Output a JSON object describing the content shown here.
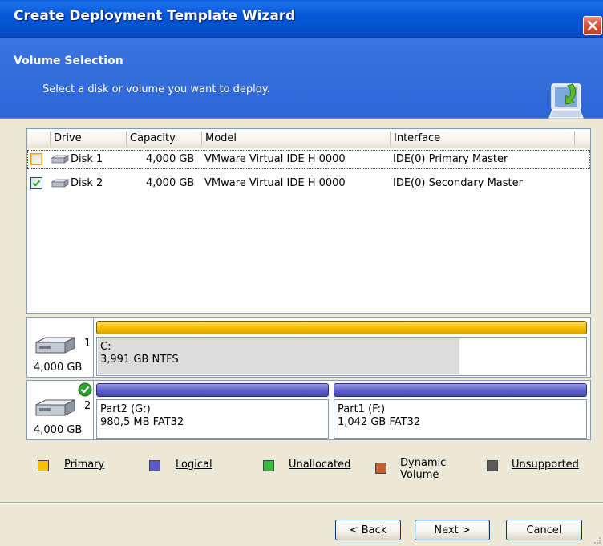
{
  "window": {
    "title": "Create Deployment Template Wizard"
  },
  "header": {
    "title": "Volume Selection",
    "subtitle": "Select a disk or volume you want to deploy."
  },
  "drive_list": {
    "columns": [
      "Drive",
      "Capacity",
      "Model",
      "Interface"
    ],
    "rows": [
      {
        "checked": false,
        "drive": "Disk 1",
        "capacity": "4,000 GB",
        "model": "VMware Virtual IDE H 0000",
        "interface": "IDE(0) Primary Master"
      },
      {
        "checked": true,
        "drive": "Disk 2",
        "capacity": "4,000 GB",
        "model": "VMware Virtual IDE H 0000",
        "interface": "IDE(0) Secondary Master"
      }
    ]
  },
  "disk_map": [
    {
      "number": "1",
      "size": "4,000 GB",
      "selected": false,
      "partitions": [
        {
          "type": "primary",
          "name": "C:",
          "info": "3,991 GB  NTFS",
          "used_fraction": 0.74
        }
      ]
    },
    {
      "number": "2",
      "size": "4,000 GB",
      "selected": true,
      "partitions": [
        {
          "type": "logical",
          "name": "Part2 (G:)",
          "info": "980,5 MB  FAT32"
        },
        {
          "type": "logical",
          "name": "Part1 (F:)",
          "info": "1,042 GB  FAT32"
        }
      ]
    }
  ],
  "legend": [
    {
      "label": "Primary",
      "color": "#F5C000"
    },
    {
      "label": "Logical",
      "color": "#5A5AD0"
    },
    {
      "label": "Unallocated",
      "color": "#3CB83C"
    },
    {
      "label": "Dynamic",
      "label2": "Volume",
      "color": "#C0602C"
    },
    {
      "label": "Unsupported",
      "color": "#5A5A5A"
    }
  ],
  "buttons": {
    "back": "< Back",
    "next": "Next >",
    "cancel": "Cancel"
  },
  "colors": {
    "titlebar": "#0453D0",
    "header": "#3B74E0",
    "dialog_bg": "#ECE9D8"
  }
}
